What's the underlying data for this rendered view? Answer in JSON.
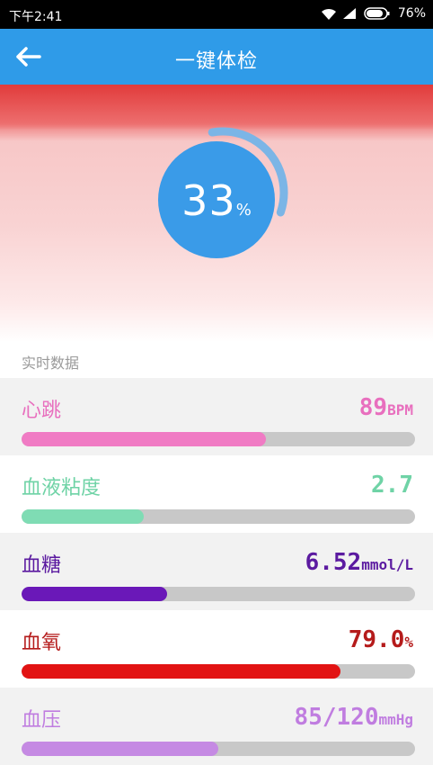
{
  "status_bar": {
    "time": "下午2:41",
    "battery": "76%"
  },
  "app_bar": {
    "title": "一键体检"
  },
  "progress": {
    "value": 33,
    "unit": "%"
  },
  "section": {
    "title": "实时数据"
  },
  "metrics": [
    {
      "label": "心跳",
      "value": "89",
      "unit": "BPM",
      "color": "#e86fbe",
      "bar_color": "#f07bc4",
      "level": 0.62,
      "bg": "#f2f2f2"
    },
    {
      "label": "血液粘度",
      "value": "2.7",
      "unit": "",
      "color": "#6fd3a6",
      "bar_color": "#7fdcb4",
      "level": 0.31,
      "bg": "#ffffff"
    },
    {
      "label": "血糖",
      "value": "6.52",
      "unit": "mmol/L",
      "color": "#5b1aa0",
      "bar_color": "#6a18b8",
      "level": 0.37,
      "bg": "#f2f2f2"
    },
    {
      "label": "血氧",
      "value": "79.0",
      "unit": "%",
      "color": "#b51b1b",
      "bar_color": "#e21313",
      "level": 0.81,
      "bg": "#ffffff"
    },
    {
      "label": "血压",
      "value": "85/120",
      "unit": "mmHg",
      "color": "#c07de0",
      "bar_color": "#c58ae3",
      "level": 0.5,
      "bg": "#f2f2f2"
    }
  ]
}
